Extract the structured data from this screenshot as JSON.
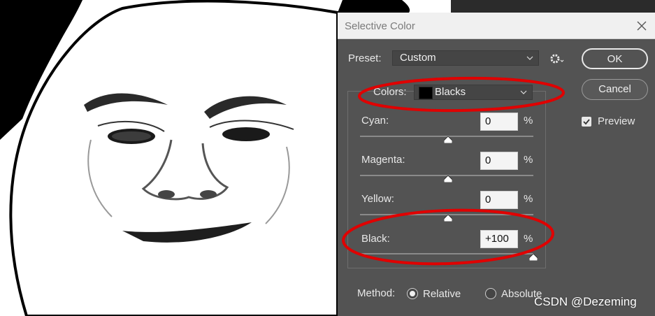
{
  "dialog": {
    "title": "Selective Color",
    "preset_label": "Preset:",
    "preset_value": "Custom",
    "colors_label": "Colors:",
    "colors_value": "Blacks",
    "ok_label": "OK",
    "cancel_label": "Cancel",
    "preview_label": "Preview",
    "preview_checked": true,
    "sliders": [
      {
        "label": "Cyan:",
        "value": "0",
        "unit": "%"
      },
      {
        "label": "Magenta:",
        "value": "0",
        "unit": "%"
      },
      {
        "label": "Yellow:",
        "value": "0",
        "unit": "%"
      },
      {
        "label": "Black:",
        "value": "+100",
        "unit": "%"
      }
    ],
    "method_label": "Method:",
    "methods": [
      {
        "label": "Relative",
        "selected": true
      },
      {
        "label": "Absolute",
        "selected": false
      }
    ]
  },
  "watermark": "CSDN @Dezeming",
  "colors": {
    "dialog_bg": "#535353",
    "annotation": "#e00000",
    "titlebar": "#f0f0f0"
  },
  "icons": [
    "close-icon",
    "chevron-down-icon",
    "gear-icon",
    "checkmark-icon",
    "slider-thumb-icon"
  ]
}
